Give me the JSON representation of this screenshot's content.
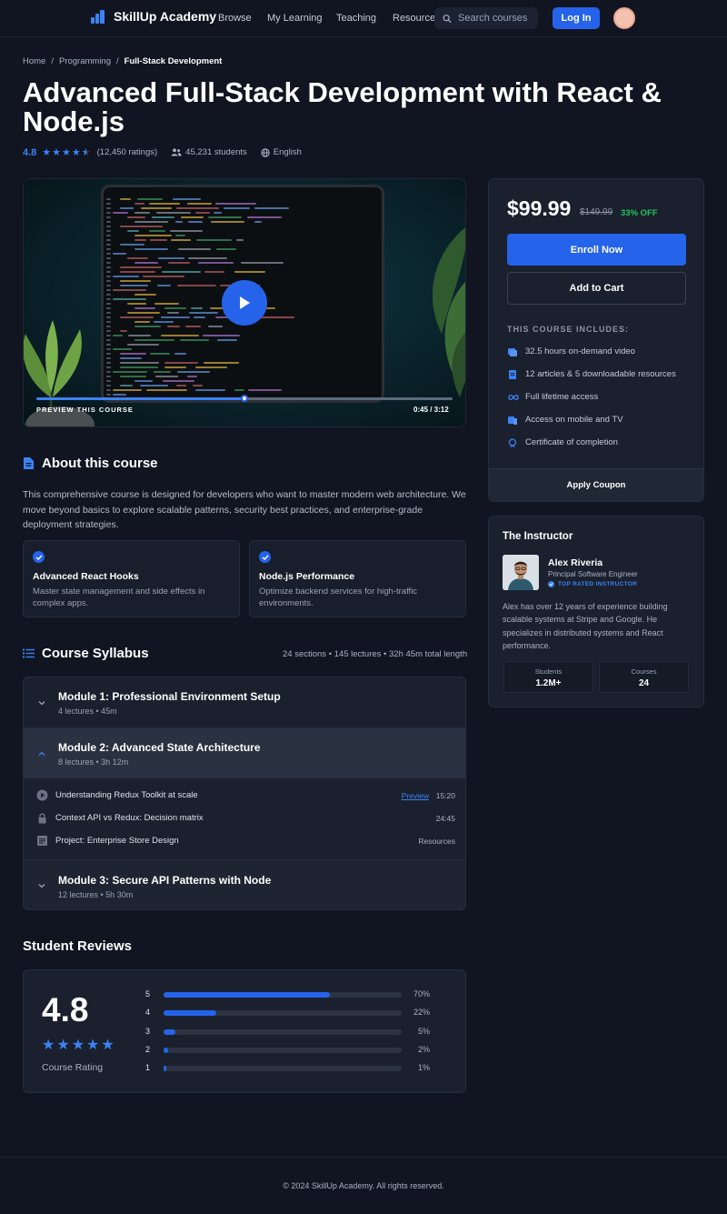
{
  "header": {
    "brand": "SkillUp Academy",
    "nav": [
      "Browse",
      "My Learning",
      "Teaching",
      "Resources"
    ],
    "search_placeholder": "Search courses",
    "login_label": "Log In"
  },
  "breadcrumb": [
    "Home",
    "Programming",
    "Full-Stack Development"
  ],
  "course": {
    "title": "Advanced Full-Stack Development with React & Node.js",
    "rating": "4.8",
    "rating_value": 4.5,
    "ratings_count": "(12,450 ratings)",
    "students": "45,231 students",
    "language": "English"
  },
  "video": {
    "preview_label": "PREVIEW THIS COURSE",
    "time": "0:45 / 3:12",
    "progress": 0.5
  },
  "about": {
    "heading": "About this course",
    "text": "This comprehensive course is designed for developers who want to master modern web architecture. We move beyond basics to explore scalable patterns, security best practices, and enterprise-grade deployment strategies.",
    "features": [
      {
        "title": "Advanced React Hooks",
        "desc": "Master state management and side effects in complex apps."
      },
      {
        "title": "Node.js Performance",
        "desc": "Optimize backend services for high-traffic environments."
      }
    ]
  },
  "syllabus": {
    "heading": "Course Syllabus",
    "meta": "24 sections • 145 lectures • 32h 45m total length",
    "modules": [
      {
        "title": "Module 1: Professional Environment Setup",
        "sub": "4 lectures • 45m"
      },
      {
        "title": "Module 2: Advanced State Architecture",
        "sub": "8 lectures • 3h 12m"
      },
      {
        "title": "Module 3: Secure API Patterns with Node",
        "sub": "12 lectures • 5h 30m"
      }
    ],
    "lectures": [
      {
        "name": "Understanding Redux Toolkit at scale",
        "preview": "Preview",
        "right": "15:20"
      },
      {
        "name": "Context API vs Redux: Decision matrix",
        "right": "24:45"
      },
      {
        "name": "Project: Enterprise Store Design",
        "right": "Resources"
      }
    ]
  },
  "reviews": {
    "heading": "Student Reviews",
    "score": "4.8",
    "label": "Course Rating",
    "breakdown": [
      {
        "star": "5",
        "pct": "70%",
        "value": 70
      },
      {
        "star": "4",
        "pct": "22%",
        "value": 22
      },
      {
        "star": "3",
        "pct": "5%",
        "value": 5
      },
      {
        "star": "2",
        "pct": "2%",
        "value": 2
      },
      {
        "star": "1",
        "pct": "1%",
        "value": 1
      }
    ]
  },
  "pricing": {
    "price": "$99.99",
    "old_price": "$149.99",
    "discount": "33% OFF",
    "enroll_label": "Enroll Now",
    "cart_label": "Add to Cart",
    "includes_heading": "THIS COURSE INCLUDES:",
    "includes": [
      "32.5 hours on-demand video",
      "12 articles & 5 downloadable resources",
      "Full lifetime access",
      "Access on mobile and TV",
      "Certificate of completion"
    ],
    "coupon_label": "Apply Coupon"
  },
  "instructor": {
    "heading": "The Instructor",
    "name": "Alex Riveria",
    "role": "Principal Software Engineer",
    "badge": "TOP RATED INSTRUCTOR",
    "bio": "Alex has over 12 years of experience building scalable systems at Stripe and Google. He specializes in distributed systems and React performance.",
    "stats": [
      {
        "label": "Students",
        "value": "1.2M+"
      },
      {
        "label": "Courses",
        "value": "24"
      }
    ]
  },
  "footer": "© 2024 SkillUp Academy. All rights reserved.",
  "colors": {
    "accent": "#2563eb",
    "success": "#22c55e",
    "background": "#101521",
    "card": "#1a202d"
  }
}
